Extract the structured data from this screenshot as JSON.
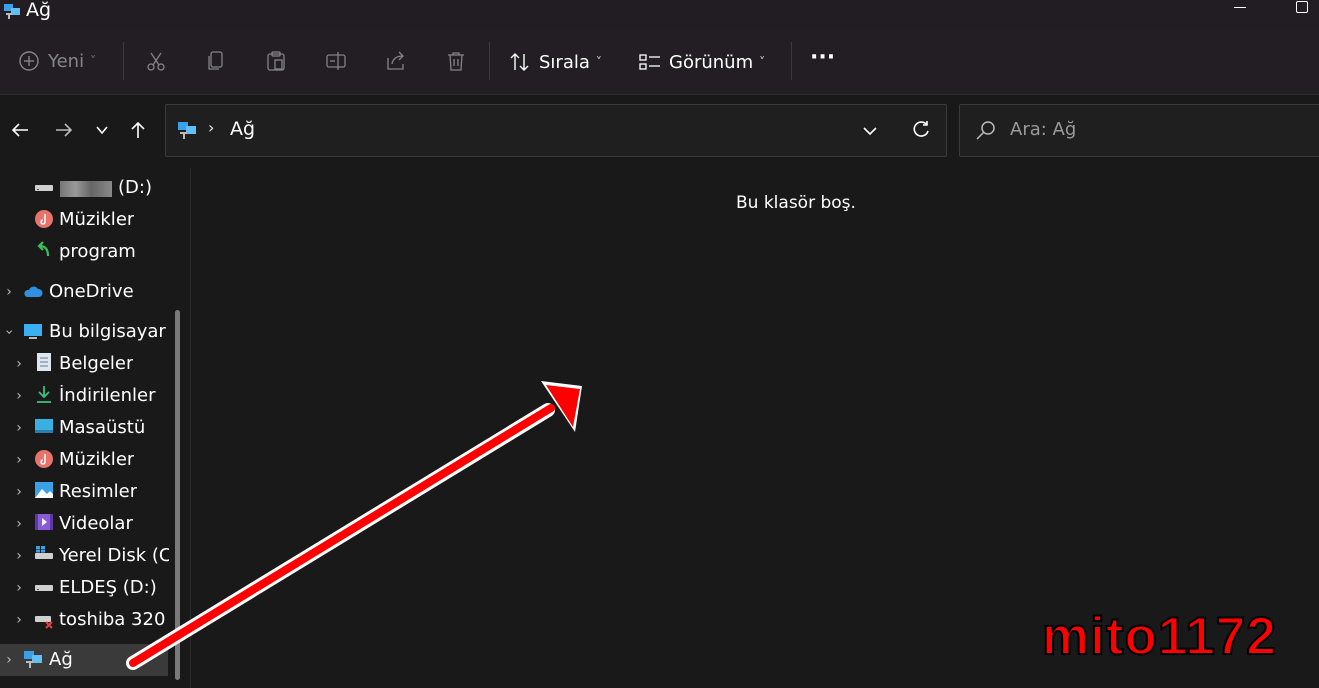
{
  "window": {
    "title": "Ağ"
  },
  "toolbar": {
    "new_label": "Yeni",
    "sort_label": "Sırala",
    "view_label": "Görünüm",
    "more_label": "···"
  },
  "address": {
    "separator": "›",
    "path": "Ağ"
  },
  "search": {
    "placeholder": "Ara: Ağ"
  },
  "sidebar": {
    "items": [
      {
        "label": "(D:)",
        "icon": "drive-icon"
      },
      {
        "label": "Müzikler",
        "icon": "music-icon"
      },
      {
        "label": "program",
        "icon": "shortcut-icon"
      },
      {
        "label": "OneDrive",
        "icon": "cloud-icon"
      },
      {
        "label": "Bu bilgisayar",
        "icon": "computer-icon"
      },
      {
        "label": "Belgeler",
        "icon": "documents-icon"
      },
      {
        "label": "İndirilenler",
        "icon": "download-icon"
      },
      {
        "label": "Masaüstü",
        "icon": "desktop-icon"
      },
      {
        "label": "Müzikler",
        "icon": "music-icon"
      },
      {
        "label": "Resimler",
        "icon": "pictures-icon"
      },
      {
        "label": "Videolar",
        "icon": "videos-icon"
      },
      {
        "label": "Yerel Disk (C:",
        "icon": "system-drive-icon"
      },
      {
        "label": "ELDEŞ (D:)",
        "icon": "drive-icon"
      },
      {
        "label": "toshiba 320",
        "icon": "disconnected-drive-icon"
      },
      {
        "label": "Ağ",
        "icon": "network-icon"
      }
    ]
  },
  "content": {
    "empty_message": "Bu klasör boş."
  },
  "watermark": {
    "text": "mito1172"
  },
  "colors": {
    "background": "#191919",
    "toolbar": "#221e24",
    "selected": "#3a3a3a",
    "annotation": "#ff0000",
    "watermark": "#ff0000"
  }
}
